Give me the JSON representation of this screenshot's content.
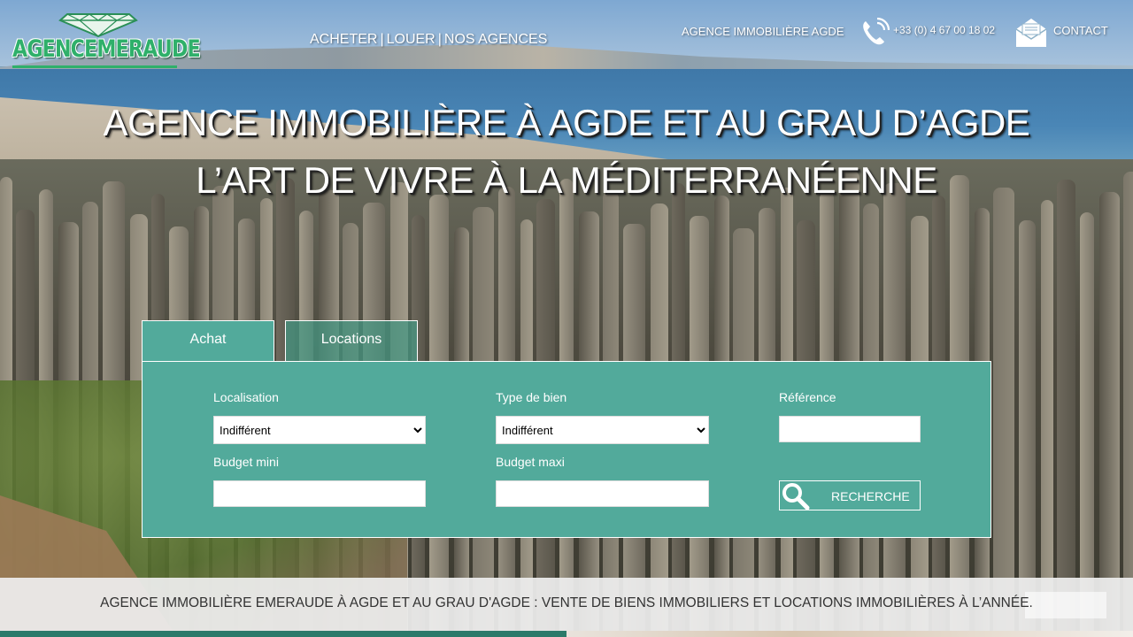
{
  "header": {
    "logo_text": "AGENCEMERAUDE",
    "nav": {
      "buy": "ACHETER",
      "rent": "LOUER",
      "agencies": "NOS AGENCES",
      "separator": "|"
    },
    "agency_label": "AGENCE IMMOBILIÈRE AGDE",
    "phone": "+33 (0) 4 67 00 18 02",
    "contact": "CONTACT",
    "icons": {
      "phone": "phone-icon",
      "mail": "mail-icon",
      "logo_gem": "diamond-icon"
    }
  },
  "hero": {
    "line1": "AGENCE IMMOBILIÈRE À AGDE ET AU GRAU D’AGDE",
    "line2": "L’ART DE VIVRE À LA MÉDITERRANÉENNE"
  },
  "search": {
    "tabs": [
      {
        "label": "Achat",
        "active": true
      },
      {
        "label": "Locations",
        "active": false
      }
    ],
    "fields": {
      "localisation": {
        "label": "Localisation",
        "value": "Indifférent"
      },
      "type": {
        "label": "Type de bien",
        "value": "Indifférent"
      },
      "reference": {
        "label": "Référence",
        "value": ""
      },
      "budget_min": {
        "label": "Budget mini",
        "value": ""
      },
      "budget_max": {
        "label": "Budget maxi",
        "value": ""
      }
    },
    "button": "RECHERCHE",
    "button_icon": "search-icon"
  },
  "banner": {
    "text": "AGENCE IMMOBILIÈRE EMERAUDE À AGDE ET AU GRAU D'AGDE : VENTE DE BIENS IMMOBILIERS ET LOCATIONS IMMOBILIÈRES À L’ANNÉE."
  },
  "colors": {
    "panel": "#52aa9b",
    "logo_green": "#2fb06a",
    "banner_bg": "#eeeeee",
    "banner_text": "#333333"
  }
}
